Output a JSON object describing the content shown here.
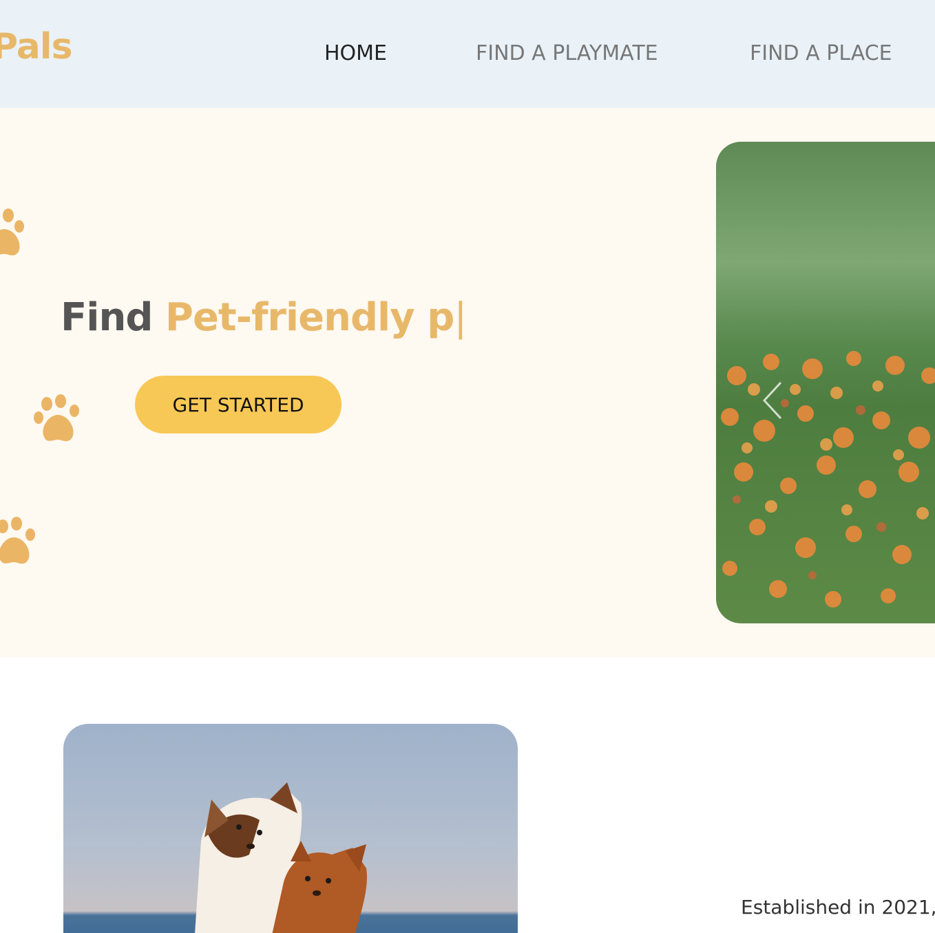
{
  "header": {
    "logo": "Pals",
    "nav": [
      {
        "label": "HOME",
        "active": true
      },
      {
        "label": "FIND A PLAYMATE",
        "active": false
      },
      {
        "label": "FIND A PLACE",
        "active": false
      }
    ]
  },
  "hero": {
    "title_prefix": "Find",
    "title_highlight": "Pet-friendly p",
    "caret": "|",
    "cta_label": "GET STARTED",
    "carousel_prev_icon": "chevron-left-icon",
    "paw_icon": "paw-print-icon"
  },
  "about": {
    "text": "Established in 2021,"
  },
  "colors": {
    "header_bg": "#eaf2f8",
    "hero_bg": "#fef9f1",
    "accent": "#e8b86a",
    "button": "#f8c856",
    "nav_active": "#222222",
    "nav_inactive": "#777777"
  }
}
